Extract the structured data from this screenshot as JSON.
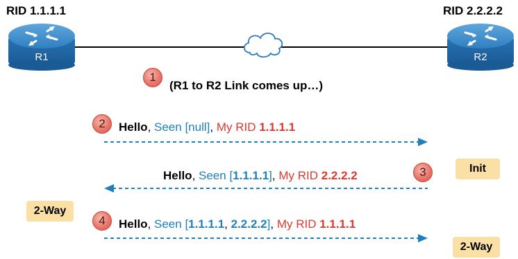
{
  "routers": [
    {
      "rid_label": "RID 1.1.1.1",
      "name": "R1"
    },
    {
      "rid_label": "RID 2.2.2.2",
      "name": "R2"
    }
  ],
  "link_note": "(R1 to R2 Link comes up…)",
  "steps": [
    "1",
    "2",
    "3",
    "4"
  ],
  "messages": [
    {
      "hello": "Hello",
      "sep1": ", ",
      "seen_prefix": "Seen [",
      "seen_values": "null",
      "seen_suffix": "]",
      "sep2": ", ",
      "rid_prefix": "My RID ",
      "rid_value": "1.1.1.1",
      "direction": "R1 to R2"
    },
    {
      "hello": "Hello",
      "sep1": ", ",
      "seen_prefix": "Seen [",
      "seen_values": "1.1.1.1",
      "seen_suffix": "]",
      "sep2": ", ",
      "rid_prefix": "My RID ",
      "rid_value": "2.2.2.2",
      "direction": "R2 to R1"
    },
    {
      "hello": "Hello",
      "sep1": ", ",
      "seen_prefix": "Seen [",
      "seen_value_a": "1.1.1.1",
      "seen_sep": ", ",
      "seen_value_b": "2.2.2.2",
      "seen_suffix": "]",
      "sep2": ", ",
      "rid_prefix": "My RID ",
      "rid_value": "1.1.1.1",
      "direction": "R1 to R2"
    }
  ],
  "states": {
    "r2_init": "Init",
    "r1_two_way": "2-Way",
    "r2_two_way": "2-Way"
  },
  "colors": {
    "router_fill": "#2a7bbf",
    "arrow": "#1f7fbd",
    "state_bg": "#fbe0a6",
    "step_badge": "#e8776a",
    "rid_red": "#d93a2f",
    "seen_blue": "#1f7fbd"
  },
  "icons": [
    "router-icon",
    "cloud-icon",
    "dashed-arrow-right-icon",
    "dashed-arrow-left-icon"
  ]
}
